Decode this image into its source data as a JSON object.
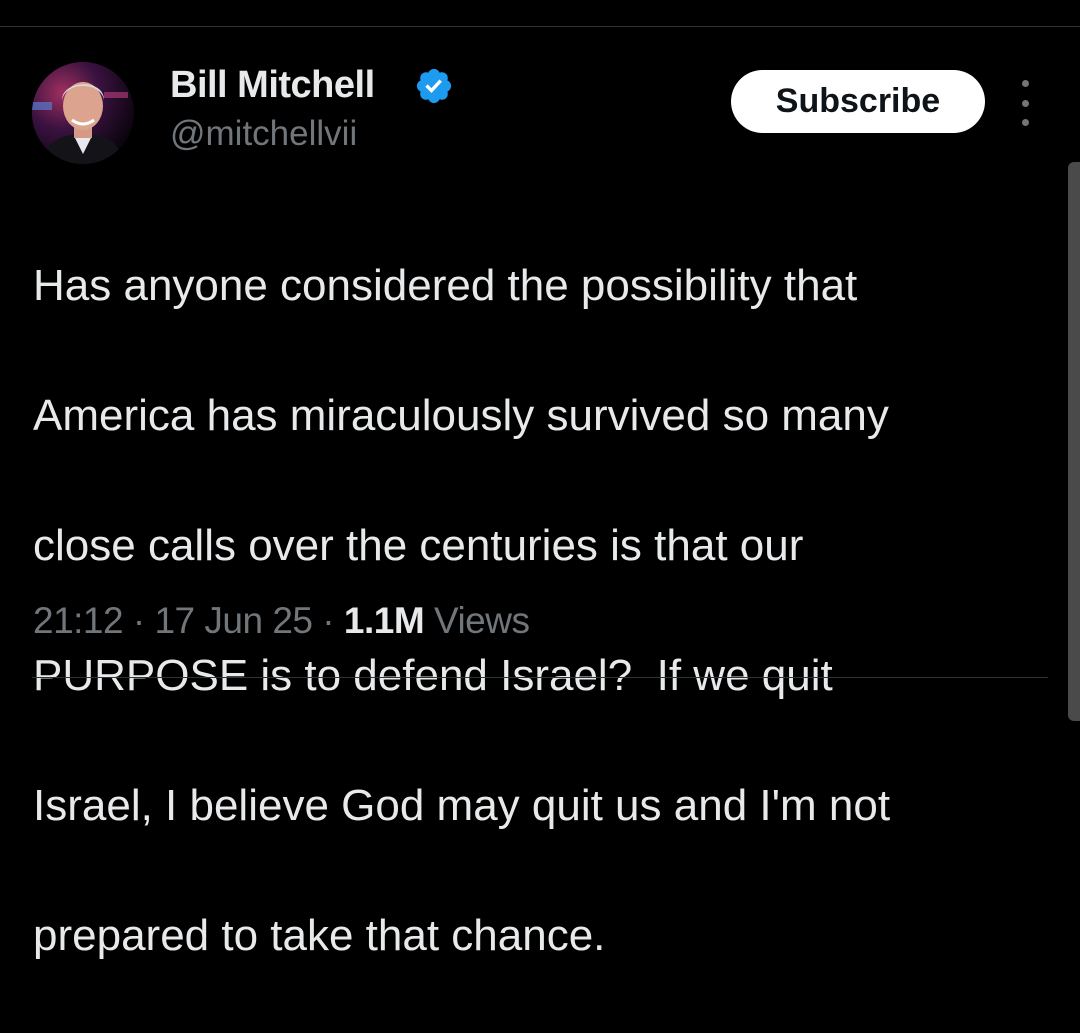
{
  "author": {
    "display_name": "Bill Mitchell",
    "handle": "@mitchellvii",
    "verified_icon": "verified-badge-icon",
    "avatar_icon": "profile-photo"
  },
  "actions": {
    "subscribe_label": "Subscribe",
    "more_icon": "more-vertical-icon"
  },
  "tweet": {
    "lines": [
      "Has anyone considered the possibility that",
      "America has miraculously survived so many",
      "close calls over the centuries is that our",
      "PURPOSE is to defend Israel?  If we quit",
      "Israel, I believe God may quit us and I'm not",
      "prepared to take that chance."
    ]
  },
  "meta": {
    "time": "21:12",
    "separator": " · ",
    "date": "17 Jun 25",
    "views_count": "1.1M",
    "views_label": "Views"
  },
  "colors": {
    "background": "#000000",
    "text_primary": "#e7e9ea",
    "text_secondary": "#71767b",
    "verified_blue": "#1d9bf0",
    "subscribe_bg": "#ffffff"
  }
}
